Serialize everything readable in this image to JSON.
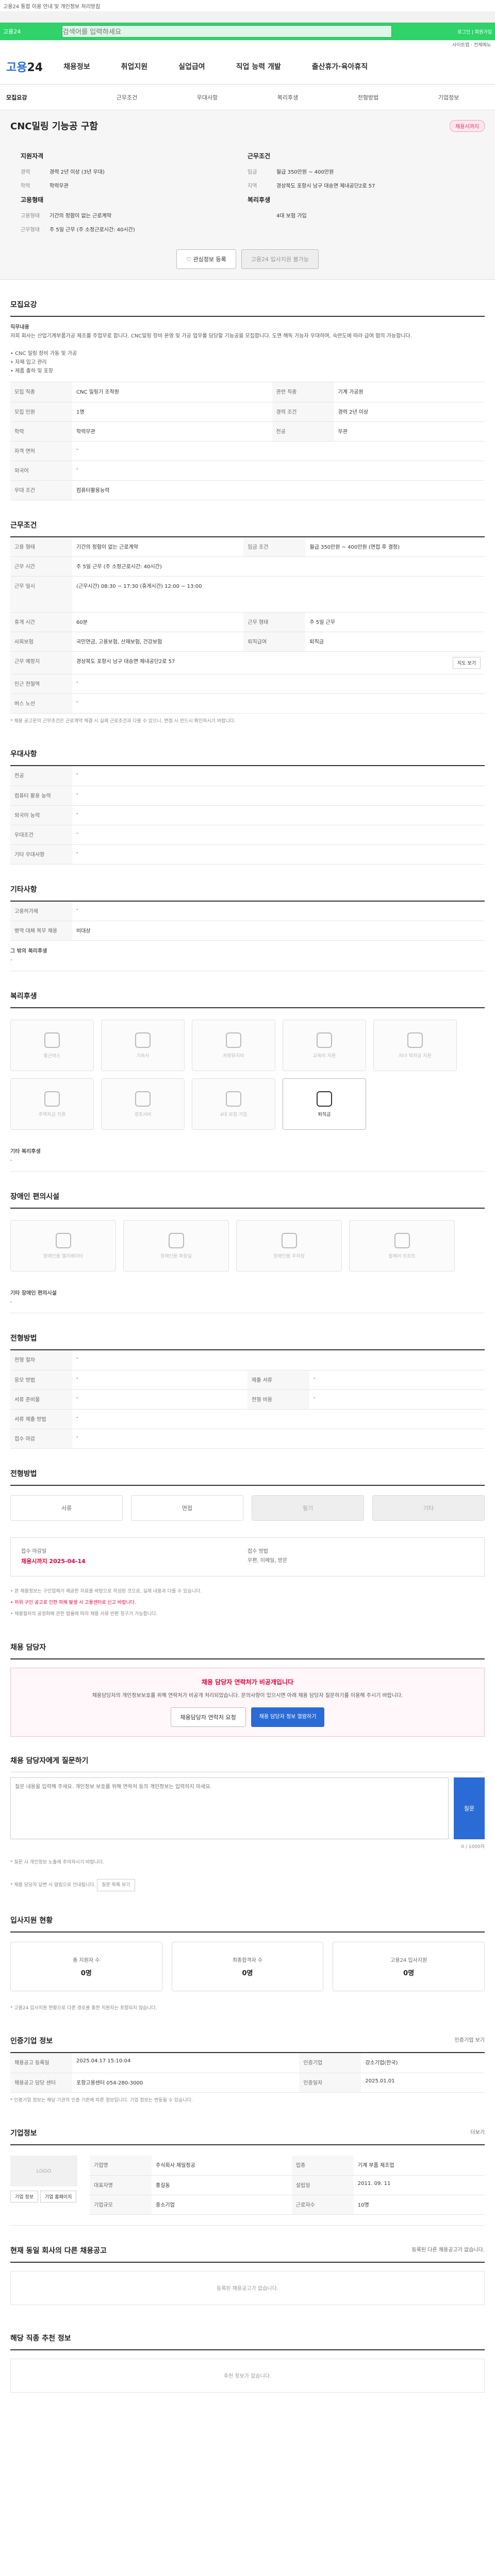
{
  "top": {
    "notice": "고용24 통합 이용 안내 및 개인정보 처리방침",
    "service": "고용24",
    "search_placeholder": "검색어를 입력하세요",
    "top_link": "로그인 | 회원가입"
  },
  "sub": "사이트맵 · 전체메뉴",
  "nav": {
    "brand_a": "고용",
    "brand_b": "24",
    "items": [
      "채용정보",
      "취업지원",
      "실업급여",
      "직업 능력 개발",
      "출산휴가·육아휴직"
    ]
  },
  "subnav": [
    "모집요강",
    "근무조건",
    "우대사항",
    "복리후생",
    "전형방법",
    "기업정보"
  ],
  "title": "CNC밀링 기능공 구함",
  "badge": "채용시까지",
  "summary": {
    "h_left": "지원자격",
    "h_right": "근무조건",
    "left": [
      {
        "k": "경력",
        "v": "경력 2년 이상 (3년 우대)"
      },
      {
        "k": "학력",
        "v": "학력무관"
      }
    ],
    "right": [
      {
        "k": "임금",
        "v": "월급 350만원 ~ 400만원"
      },
      {
        "k": "지역",
        "v": "경상북도 포항시 남구 대송면 제내공단2로 57"
      }
    ],
    "h_left2": "고용형태",
    "h_right2": "복리후생",
    "left2": [
      {
        "k": "고용형태",
        "v": "기간의 정함이 없는 근로계약"
      },
      {
        "k": "근무형태",
        "v": "주 5일 근무 (주 소정근로시간: 40시간)"
      }
    ],
    "right2": [
      {
        "k": "",
        "v": "4대 보험 가입"
      }
    ]
  },
  "buttons": {
    "scrap": "관심정보 등록",
    "apply": "고용24 입사지원 불가능"
  },
  "s1": {
    "title": "모집요강",
    "desc_title": "직무내용",
    "desc": "저희 회사는 산업기계부품가공 제조를 주업무로 합니다. CNC밀링 장비 운영 및 가공 업무를 담당할 기능공을 모집합니다. 도면 해독 가능자 우대하며, 숙련도에 따라 급여 협의 가능합니다.",
    "bullets": "• CNC 밀링 장비 가동 및 가공\n• 자재 입고 관리\n• 제품 출하 및 포장",
    "rows": [
      [
        "모집 직종",
        "CNC 밀링기 조작원",
        "관련 직종",
        "기계 가공원"
      ],
      [
        "모집 인원",
        "1명",
        "경력 조건",
        "경력 2년 이상"
      ],
      [
        "학력",
        "학력무관",
        "전공",
        "무관"
      ],
      [
        "자격 면허",
        "-",
        "",
        ""
      ],
      [
        "외국어",
        "-",
        "",
        ""
      ],
      [
        "우대 조건",
        "컴퓨터활용능력",
        "",
        ""
      ]
    ]
  },
  "s2": {
    "title": "근무조건",
    "rows": [
      [
        "고용 형태",
        "기간의 정함이 없는 근로계약",
        "임금 조건",
        "월급 350만원 ~ 400만원 (면접 후 결정)"
      ],
      [
        "근무 시간",
        "주 5일 근무 (주 소정근로시간: 40시간)",
        "",
        ""
      ],
      [
        "근무 일시",
        "(근무시간) 08:30 ~ 17:30 (휴게시간) 12:00 ~ 13:00",
        "",
        ""
      ],
      [
        "휴게 시간",
        "60분",
        "근무 형태",
        "주 5일 근무"
      ],
      [
        "사회보험",
        "국민연금, 고용보험, 산재보험, 건강보험",
        "퇴직급여",
        "퇴직금"
      ],
      [
        "근무 예정지",
        "경상북도 포항시 남구 대송면 제내공단2로 57",
        "",
        ""
      ],
      [
        "인근 전철역",
        "-",
        "",
        ""
      ],
      [
        "버스 노선",
        "-",
        "",
        ""
      ]
    ],
    "note": "* 채용 공고문의 근무조건은 근로계약 체결 시 실제 근로조건과 다를 수 있으니, 면접 시 반드시 확인하시기 바랍니다.",
    "map_btn": "지도 보기"
  },
  "s3": {
    "title": "우대사항",
    "rows": [
      [
        "전공",
        "-"
      ],
      [
        "컴퓨터 활용 능력",
        "-"
      ],
      [
        "외국어 능력",
        "-"
      ],
      [
        "우대조건",
        "-"
      ],
      [
        "기타 우대사항",
        "-"
      ]
    ]
  },
  "s4": {
    "title": "기타사항",
    "rows": [
      [
        "고용허가제",
        "-"
      ],
      [
        "병역 대체 복무 채용",
        "비대상"
      ]
    ],
    "extra_title": "그 밖의 복리후생",
    "extra": "-"
  },
  "s5": {
    "title": "복리후생",
    "tiles": [
      "통근버스",
      "기숙사",
      "차량유지비",
      "교육비 지원",
      "자녀 학자금 지원",
      "주택자금 지원",
      "경조사비",
      "4대 보험 가입",
      "퇴직금",
      "우수사원 포상"
    ],
    "note_title": "기타 복리후생",
    "note": "-"
  },
  "s6": {
    "title": "장애인 편의시설",
    "tiles": [
      "장애인용 엘리베이터",
      "장애인용 화장실",
      "장애인용 주차장",
      "휠체어 리프트",
      "시각 장애인 편의시설"
    ],
    "note_title": "기타 장애인 편의시설",
    "note": "-"
  },
  "s7": {
    "title": "전형방법",
    "rows": [
      [
        "전형 절차",
        "-"
      ],
      [
        "응모 방법",
        "-",
        "제출 서류",
        "-"
      ],
      [
        "서류 준비물",
        "-",
        "전형 비용",
        "-"
      ],
      [
        "서류 제출 방법",
        "-",
        "",
        ""
      ],
      [
        "접수 마감",
        "-",
        "",
        ""
      ]
    ]
  },
  "s8": {
    "title": "전형방법",
    "regions": [
      "서류",
      "면접",
      "필기",
      "기타"
    ],
    "deadline_label": "접수 마감일",
    "deadline": "채용시까지 2025-04-14",
    "method_label": "접수 방법",
    "method": "우편, 이메일, 방문",
    "notes": [
      "• 본 채용정보는 구인업체가 제공한 자료를 바탕으로 작성된 것으로, 실제 내용과 다를 수 있습니다.",
      "• 허위 구인 공고로 인한 피해 발생 시 고용센터로 신고 바랍니다.",
      "• 채용절차의 공정화에 관한 법률에 따라 채용 서류 반환 청구가 가능합니다."
    ]
  },
  "s9": {
    "title": "채용 담당자",
    "alert_title": "채용 담당자 연락처가 비공개입니다",
    "alert": "채용담당자의 개인정보보호를 위해 연락처가 비공개 처리되었습니다. 문의사항이 있으시면 아래 채용 담당자 질문하기를 이용해 주시기 바랍니다.",
    "btn1": "채용담당자 연락처 요청",
    "btn2": "채용 담당자 정보 열람하기"
  },
  "s10": {
    "title": "채용 담당자에게 질문하기",
    "placeholder": "질문 내용을 입력해 주세요. 개인정보 보호를 위해 연락처 등의 개인정보는 입력하지 마세요.",
    "count": "0 / 1000자",
    "submit": "질문",
    "note1": "* 질문 시 개인정보 노출에 주의하시기 바랍니다.",
    "note2": "* 채용 담당자 답변 시 알림으로 안내됩니다.",
    "note_btn": "질문 목록 보기"
  },
  "s11": {
    "title": "입사지원 현황",
    "cards": [
      [
        "총 지원자 수",
        "0명"
      ],
      [
        "최종합격자 수",
        "0명"
      ],
      [
        "고용24 입사지원",
        "0명"
      ]
    ],
    "note": "* 고용24 입사지원 현황으로 다른 경로를 통한 지원자는 포함되지 않습니다."
  },
  "s12": {
    "title": "인증기업 정보",
    "rows": [
      [
        "채용공고 등록일",
        "2025.04.17 15:10:04",
        "인증기업",
        "강소기업(한국)"
      ],
      [
        "채용공고 담당 센터",
        "포항고용센터 054-280-3000",
        "인증일자",
        "2025.01.01"
      ]
    ],
    "more": "인증기업 보기",
    "note": "* 인증기업 정보는 해당 기관의 인증 기준에 따른 정보입니다. 기업 정보는 변동될 수 있습니다."
  },
  "s13": {
    "title": "기업정보",
    "logo": "LOGO",
    "btns": [
      "기업 정보",
      "기업 홈페이지"
    ],
    "rows": [
      [
        "기업명",
        "주식회사 제일정공",
        "업종",
        "기계 부품 제조업"
      ],
      [
        "대표자명",
        "홍길동",
        "설립일",
        "2011. 09. 11"
      ],
      [
        "기업규모",
        "중소기업",
        "근로자수",
        "10명"
      ]
    ],
    "more": "더보기"
  },
  "s14": {
    "title": "현재 동일 회사의 다른 채용공고",
    "more": "등록된 다른 채용공고가 없습니다.",
    "empty": "등록된 채용공고가 없습니다."
  },
  "s15": {
    "title": "해당 직종 추천 정보",
    "empty": "추천 정보가 없습니다."
  }
}
